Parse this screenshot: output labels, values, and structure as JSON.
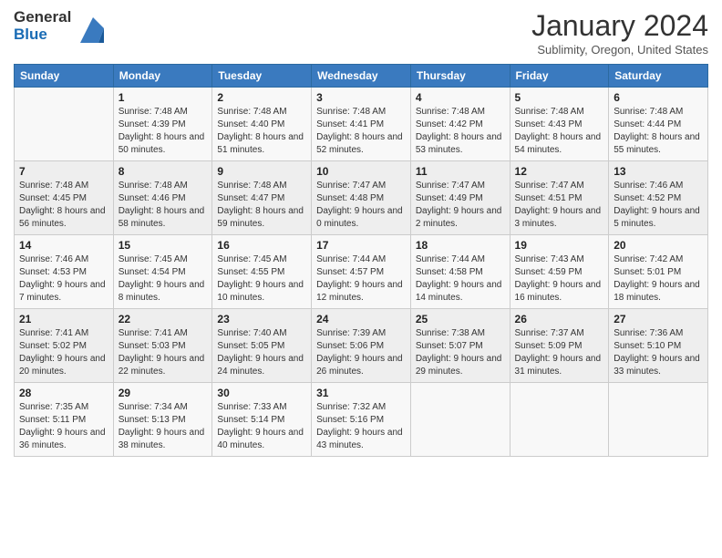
{
  "header": {
    "logo_general": "General",
    "logo_blue": "Blue",
    "month_title": "January 2024",
    "subtitle": "Sublimity, Oregon, United States"
  },
  "weekdays": [
    "Sunday",
    "Monday",
    "Tuesday",
    "Wednesday",
    "Thursday",
    "Friday",
    "Saturday"
  ],
  "weeks": [
    [
      {
        "day": "",
        "sunrise": "",
        "sunset": "",
        "daylight": ""
      },
      {
        "day": "1",
        "sunrise": "Sunrise: 7:48 AM",
        "sunset": "Sunset: 4:39 PM",
        "daylight": "Daylight: 8 hours and 50 minutes."
      },
      {
        "day": "2",
        "sunrise": "Sunrise: 7:48 AM",
        "sunset": "Sunset: 4:40 PM",
        "daylight": "Daylight: 8 hours and 51 minutes."
      },
      {
        "day": "3",
        "sunrise": "Sunrise: 7:48 AM",
        "sunset": "Sunset: 4:41 PM",
        "daylight": "Daylight: 8 hours and 52 minutes."
      },
      {
        "day": "4",
        "sunrise": "Sunrise: 7:48 AM",
        "sunset": "Sunset: 4:42 PM",
        "daylight": "Daylight: 8 hours and 53 minutes."
      },
      {
        "day": "5",
        "sunrise": "Sunrise: 7:48 AM",
        "sunset": "Sunset: 4:43 PM",
        "daylight": "Daylight: 8 hours and 54 minutes."
      },
      {
        "day": "6",
        "sunrise": "Sunrise: 7:48 AM",
        "sunset": "Sunset: 4:44 PM",
        "daylight": "Daylight: 8 hours and 55 minutes."
      }
    ],
    [
      {
        "day": "7",
        "sunrise": "Sunrise: 7:48 AM",
        "sunset": "Sunset: 4:45 PM",
        "daylight": "Daylight: 8 hours and 56 minutes."
      },
      {
        "day": "8",
        "sunrise": "Sunrise: 7:48 AM",
        "sunset": "Sunset: 4:46 PM",
        "daylight": "Daylight: 8 hours and 58 minutes."
      },
      {
        "day": "9",
        "sunrise": "Sunrise: 7:48 AM",
        "sunset": "Sunset: 4:47 PM",
        "daylight": "Daylight: 8 hours and 59 minutes."
      },
      {
        "day": "10",
        "sunrise": "Sunrise: 7:47 AM",
        "sunset": "Sunset: 4:48 PM",
        "daylight": "Daylight: 9 hours and 0 minutes."
      },
      {
        "day": "11",
        "sunrise": "Sunrise: 7:47 AM",
        "sunset": "Sunset: 4:49 PM",
        "daylight": "Daylight: 9 hours and 2 minutes."
      },
      {
        "day": "12",
        "sunrise": "Sunrise: 7:47 AM",
        "sunset": "Sunset: 4:51 PM",
        "daylight": "Daylight: 9 hours and 3 minutes."
      },
      {
        "day": "13",
        "sunrise": "Sunrise: 7:46 AM",
        "sunset": "Sunset: 4:52 PM",
        "daylight": "Daylight: 9 hours and 5 minutes."
      }
    ],
    [
      {
        "day": "14",
        "sunrise": "Sunrise: 7:46 AM",
        "sunset": "Sunset: 4:53 PM",
        "daylight": "Daylight: 9 hours and 7 minutes."
      },
      {
        "day": "15",
        "sunrise": "Sunrise: 7:45 AM",
        "sunset": "Sunset: 4:54 PM",
        "daylight": "Daylight: 9 hours and 8 minutes."
      },
      {
        "day": "16",
        "sunrise": "Sunrise: 7:45 AM",
        "sunset": "Sunset: 4:55 PM",
        "daylight": "Daylight: 9 hours and 10 minutes."
      },
      {
        "day": "17",
        "sunrise": "Sunrise: 7:44 AM",
        "sunset": "Sunset: 4:57 PM",
        "daylight": "Daylight: 9 hours and 12 minutes."
      },
      {
        "day": "18",
        "sunrise": "Sunrise: 7:44 AM",
        "sunset": "Sunset: 4:58 PM",
        "daylight": "Daylight: 9 hours and 14 minutes."
      },
      {
        "day": "19",
        "sunrise": "Sunrise: 7:43 AM",
        "sunset": "Sunset: 4:59 PM",
        "daylight": "Daylight: 9 hours and 16 minutes."
      },
      {
        "day": "20",
        "sunrise": "Sunrise: 7:42 AM",
        "sunset": "Sunset: 5:01 PM",
        "daylight": "Daylight: 9 hours and 18 minutes."
      }
    ],
    [
      {
        "day": "21",
        "sunrise": "Sunrise: 7:41 AM",
        "sunset": "Sunset: 5:02 PM",
        "daylight": "Daylight: 9 hours and 20 minutes."
      },
      {
        "day": "22",
        "sunrise": "Sunrise: 7:41 AM",
        "sunset": "Sunset: 5:03 PM",
        "daylight": "Daylight: 9 hours and 22 minutes."
      },
      {
        "day": "23",
        "sunrise": "Sunrise: 7:40 AM",
        "sunset": "Sunset: 5:05 PM",
        "daylight": "Daylight: 9 hours and 24 minutes."
      },
      {
        "day": "24",
        "sunrise": "Sunrise: 7:39 AM",
        "sunset": "Sunset: 5:06 PM",
        "daylight": "Daylight: 9 hours and 26 minutes."
      },
      {
        "day": "25",
        "sunrise": "Sunrise: 7:38 AM",
        "sunset": "Sunset: 5:07 PM",
        "daylight": "Daylight: 9 hours and 29 minutes."
      },
      {
        "day": "26",
        "sunrise": "Sunrise: 7:37 AM",
        "sunset": "Sunset: 5:09 PM",
        "daylight": "Daylight: 9 hours and 31 minutes."
      },
      {
        "day": "27",
        "sunrise": "Sunrise: 7:36 AM",
        "sunset": "Sunset: 5:10 PM",
        "daylight": "Daylight: 9 hours and 33 minutes."
      }
    ],
    [
      {
        "day": "28",
        "sunrise": "Sunrise: 7:35 AM",
        "sunset": "Sunset: 5:11 PM",
        "daylight": "Daylight: 9 hours and 36 minutes."
      },
      {
        "day": "29",
        "sunrise": "Sunrise: 7:34 AM",
        "sunset": "Sunset: 5:13 PM",
        "daylight": "Daylight: 9 hours and 38 minutes."
      },
      {
        "day": "30",
        "sunrise": "Sunrise: 7:33 AM",
        "sunset": "Sunset: 5:14 PM",
        "daylight": "Daylight: 9 hours and 40 minutes."
      },
      {
        "day": "31",
        "sunrise": "Sunrise: 7:32 AM",
        "sunset": "Sunset: 5:16 PM",
        "daylight": "Daylight: 9 hours and 43 minutes."
      },
      {
        "day": "",
        "sunrise": "",
        "sunset": "",
        "daylight": ""
      },
      {
        "day": "",
        "sunrise": "",
        "sunset": "",
        "daylight": ""
      },
      {
        "day": "",
        "sunrise": "",
        "sunset": "",
        "daylight": ""
      }
    ]
  ]
}
